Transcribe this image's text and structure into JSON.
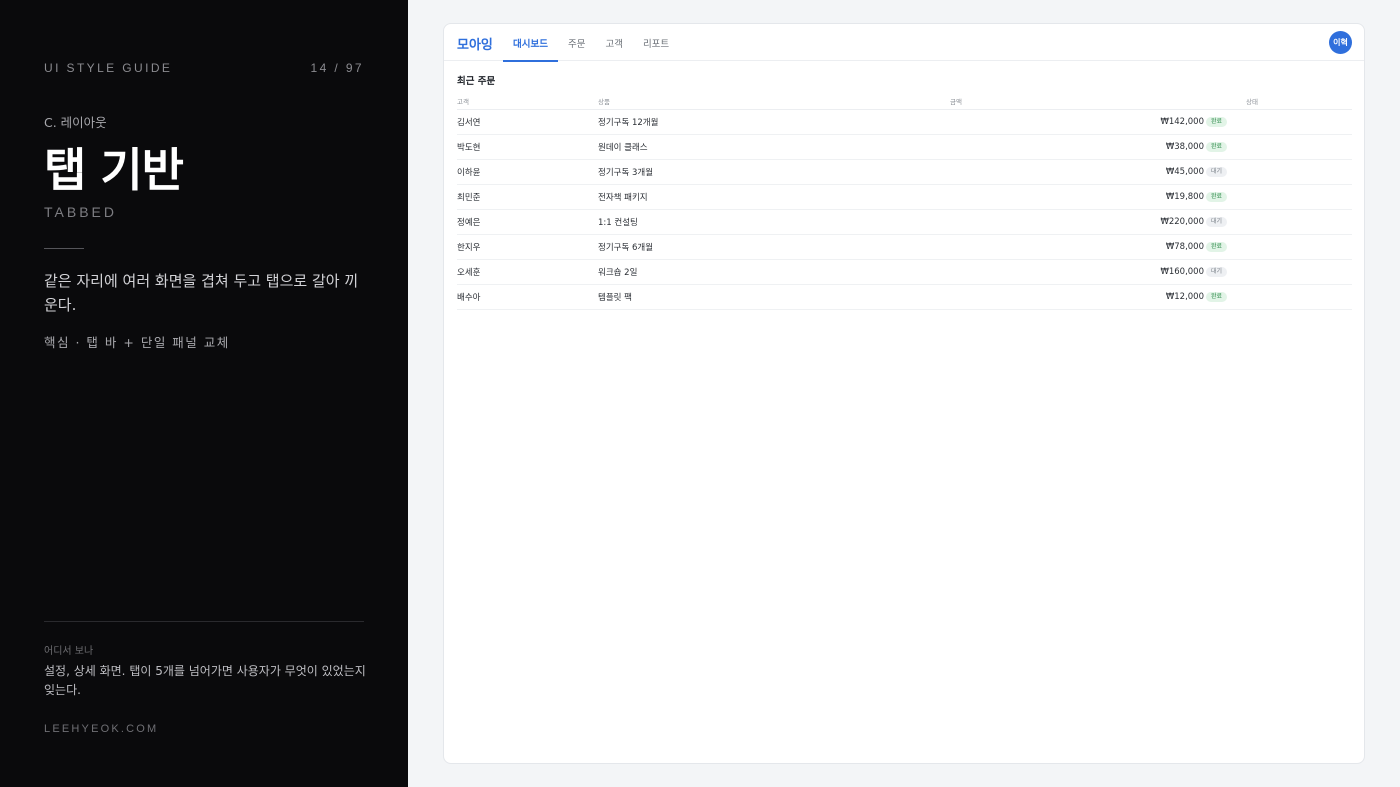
{
  "guide": {
    "eyebrow": "UI STYLE GUIDE",
    "page": "14 / 97",
    "section": "C. 레이아웃",
    "title": "탭 기반",
    "subtitle_en": "TABBED",
    "description": "같은 자리에 여러 화면을 겹쳐 두고 탭으로 갈아 끼운다.",
    "core": "핵심 · 탭 바 + 단일 패널 교체",
    "where_label": "어디서 보나",
    "where_text": "설정, 상세 화면. 탭이 5개를 넘어가면 사용자가 무엇이 있었는지 잊는다.",
    "site": "LEEHYEOK.COM"
  },
  "app": {
    "brand": "모아잉",
    "tabs": [
      {
        "label": "대시보드",
        "active": true
      },
      {
        "label": "주문",
        "active": false
      },
      {
        "label": "고객",
        "active": false
      },
      {
        "label": "리포트",
        "active": false
      }
    ],
    "avatar": "이혁",
    "section_title": "최근 주문",
    "columns": [
      "고객",
      "상품",
      "금액",
      "상태"
    ],
    "rows": [
      {
        "customer": "김서연",
        "product": "정기구독 12개월",
        "amount": "₩142,000",
        "status": "완료",
        "kind": "done"
      },
      {
        "customer": "박도현",
        "product": "원데이 클래스",
        "amount": "₩38,000",
        "status": "완료",
        "kind": "done"
      },
      {
        "customer": "이하윤",
        "product": "정기구독 3개월",
        "amount": "₩45,000",
        "status": "대기",
        "kind": "wait"
      },
      {
        "customer": "최민준",
        "product": "전자책 패키지",
        "amount": "₩19,800",
        "status": "완료",
        "kind": "done"
      },
      {
        "customer": "정예은",
        "product": "1:1 컨설팅",
        "amount": "₩220,000",
        "status": "대기",
        "kind": "wait"
      },
      {
        "customer": "한지우",
        "product": "정기구독 6개월",
        "amount": "₩78,000",
        "status": "완료",
        "kind": "done"
      },
      {
        "customer": "오세훈",
        "product": "워크숍 2일",
        "amount": "₩160,000",
        "status": "대기",
        "kind": "wait"
      },
      {
        "customer": "배수아",
        "product": "템플릿 팩",
        "amount": "₩12,000",
        "status": "완료",
        "kind": "done"
      }
    ]
  },
  "colors": {
    "accent": "#2f6fdc",
    "panel_bg": "#0a0a0c",
    "done_bg": "#e2f4e7",
    "done_fg": "#2e8a4a",
    "wait_bg": "#eef0f3",
    "wait_fg": "#7a8088"
  }
}
